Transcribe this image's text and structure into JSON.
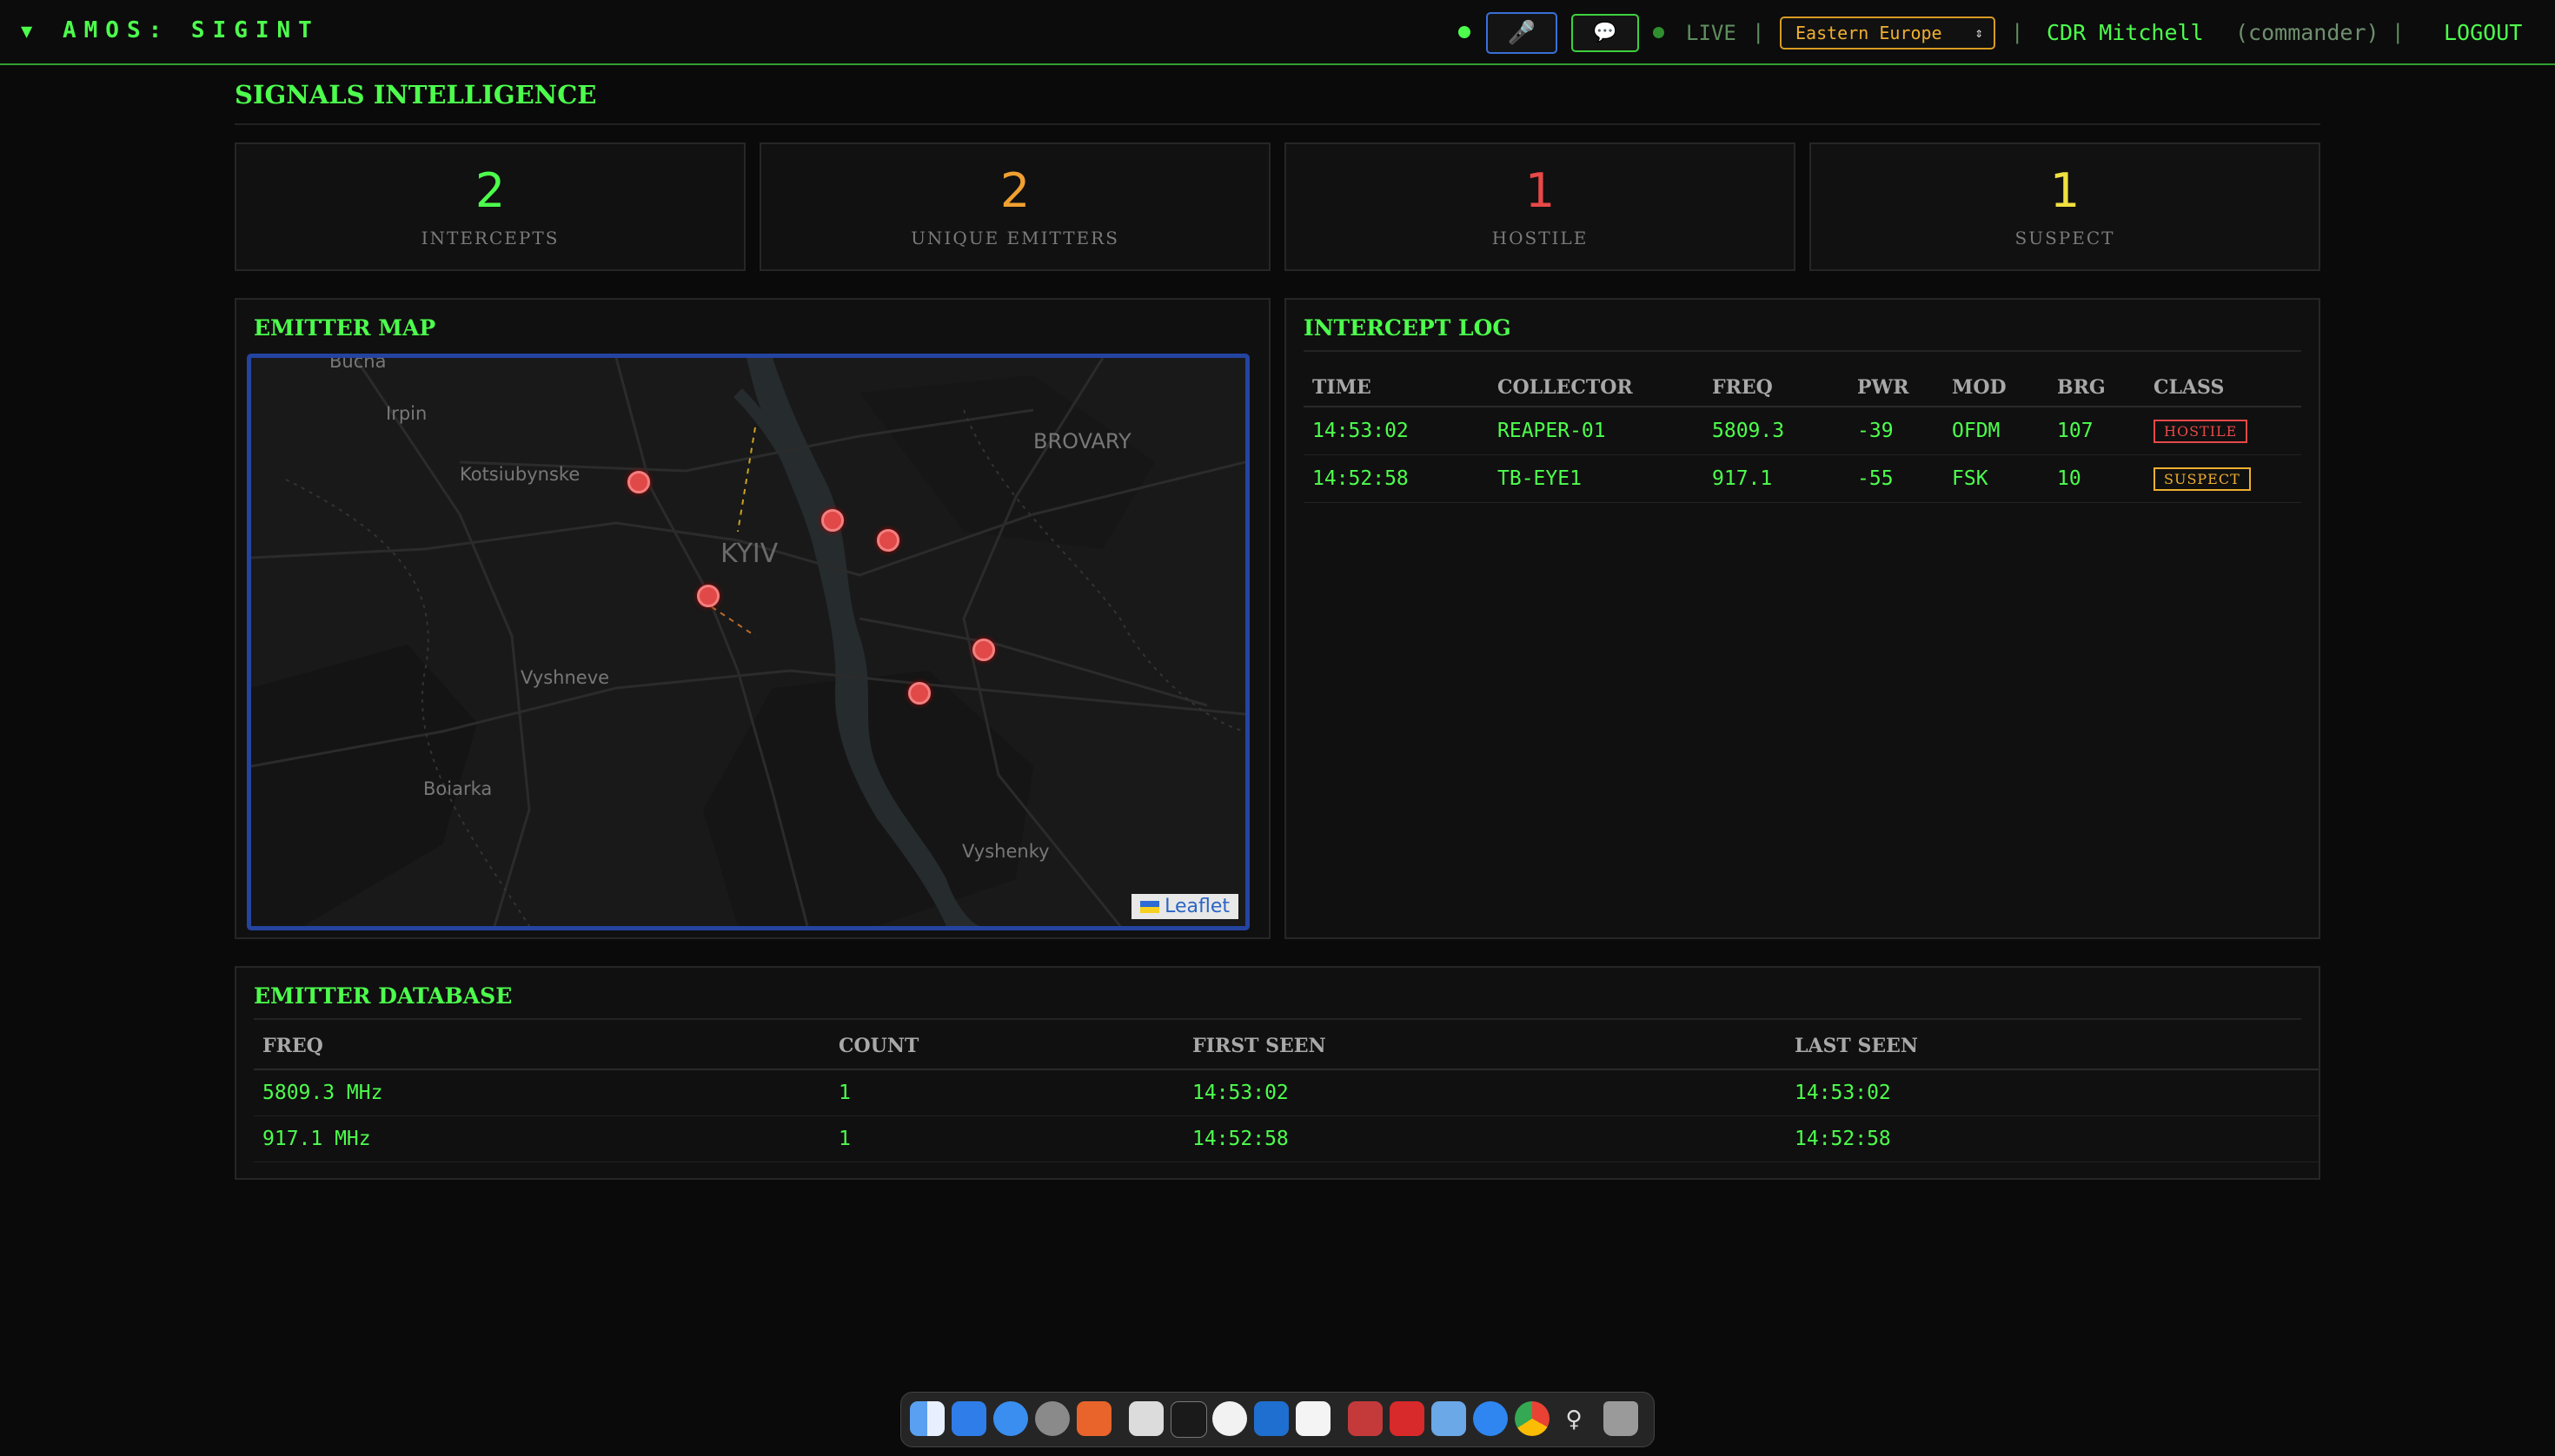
{
  "topbar": {
    "brand_caret": "▼",
    "brand": "AMOS: SIGINT",
    "mic_icon": "🎤",
    "chat_icon": "💬",
    "live_label": "LIVE",
    "separator": "|",
    "region_selected": "Eastern Europe",
    "user_name": "CDR Mitchell",
    "user_role": "(commander)",
    "logout_label": "LOGOUT",
    "status_color": "#4dff4d"
  },
  "page": {
    "title": "SIGNALS INTELLIGENCE"
  },
  "stats": [
    {
      "value": "2",
      "label": "INTERCEPTS",
      "color": "#4dff4d"
    },
    {
      "value": "2",
      "label": "UNIQUE EMITTERS",
      "color": "#f0a030"
    },
    {
      "value": "1",
      "label": "HOSTILE",
      "color": "#e84848"
    },
    {
      "value": "1",
      "label": "SUSPECT",
      "color": "#f0e040"
    }
  ],
  "emitter_map": {
    "title": "EMITTER MAP",
    "labels": {
      "bucha": "Bucha",
      "irpin": "Irpin",
      "kotsiubynske": "Kotsiubynske",
      "kyiv": "KYIV",
      "brovary": "BROVARY",
      "vyshneve": "Vyshneve",
      "boiarka": "Boiarka",
      "vyshenky": "Vyshenky"
    },
    "attribution": "Leaflet",
    "marker_color": "#e14848"
  },
  "intercept_log": {
    "title": "INTERCEPT LOG",
    "columns": [
      "TIME",
      "COLLECTOR",
      "FREQ",
      "PWR",
      "MOD",
      "BRG",
      "CLASS"
    ],
    "rows": [
      {
        "time": "14:53:02",
        "collector": "REAPER-01",
        "freq": "5809.3",
        "pwr": "-39",
        "mod": "OFDM",
        "brg": "107",
        "class": "HOSTILE"
      },
      {
        "time": "14:52:58",
        "collector": "TB-EYE1",
        "freq": "917.1",
        "pwr": "-55",
        "mod": "FSK",
        "brg": "10",
        "class": "SUSPECT"
      }
    ],
    "class_colors": {
      "HOSTILE": "#e84848",
      "SUSPECT": "#f0b030"
    }
  },
  "emitter_database": {
    "title": "EMITTER DATABASE",
    "columns": [
      "FREQ",
      "COUNT",
      "FIRST SEEN",
      "LAST SEEN"
    ],
    "rows": [
      {
        "freq": "5809.3 MHz",
        "count": "1",
        "first_seen": "14:53:02",
        "last_seen": "14:53:02"
      },
      {
        "freq": "917.1 MHz",
        "count": "1",
        "first_seen": "14:52:58",
        "last_seen": "14:52:58"
      }
    ]
  },
  "dock": {
    "icons": [
      "finder-icon",
      "mail-icon",
      "safari-icon",
      "settings-icon",
      "brave-icon",
      "notes-icon",
      "terminal-icon",
      "chatgpt-icon",
      "outlook-icon",
      "textedit-icon",
      "launcher-icon",
      "acrobat-icon",
      "preview-icon",
      "appstore-icon",
      "chrome-icon",
      "venus-icon",
      "trash-icon"
    ]
  }
}
